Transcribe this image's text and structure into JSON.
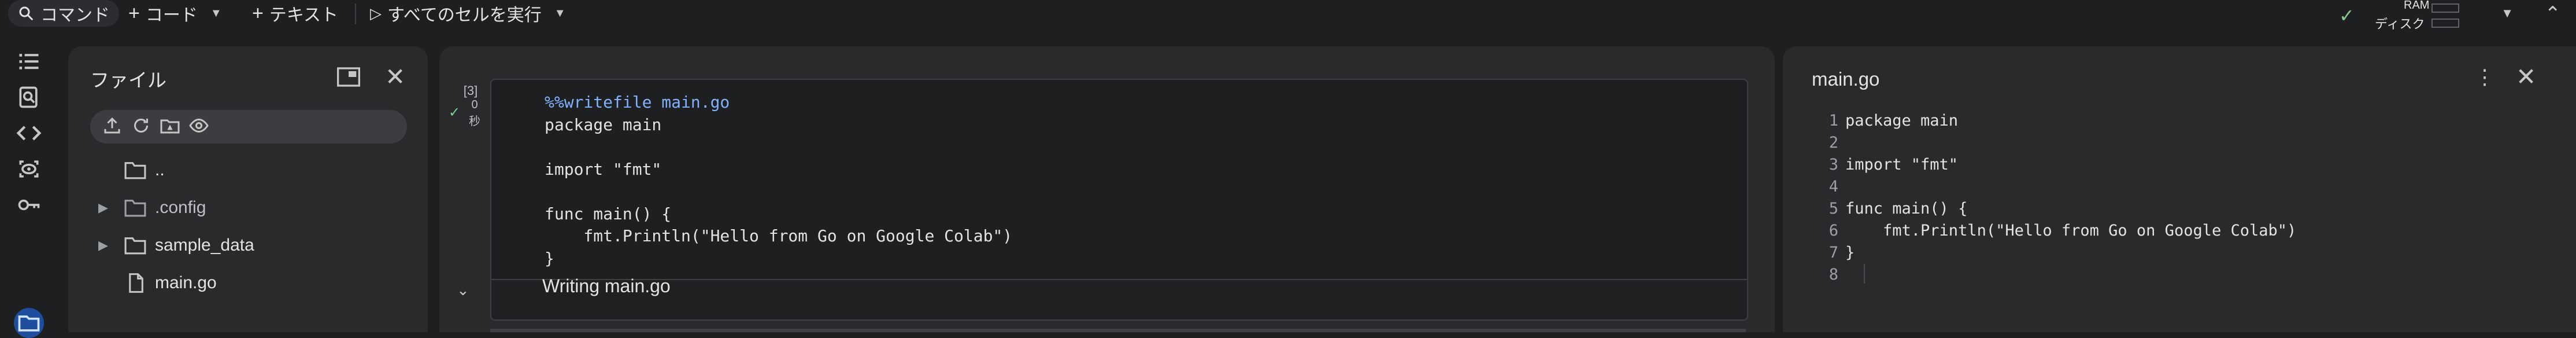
{
  "toolbar": {
    "command_label": "コマンド",
    "code_label": "コード",
    "text_label": "テキスト",
    "run_all_label": "すべてのセルを実行",
    "ram_label": "RAM",
    "disk_label": "ディスク"
  },
  "rail": {
    "icons": [
      "table-of-contents-icon",
      "find-icon",
      "code-snippets-icon",
      "variables-icon",
      "secrets-key-icon",
      "files-icon"
    ],
    "active_color": "#1f4e9e"
  },
  "files_panel": {
    "title": "ファイル",
    "tree": [
      {
        "name": "..",
        "type": "folder"
      },
      {
        "name": ".config",
        "type": "folder"
      },
      {
        "name": "sample_data",
        "type": "folder"
      },
      {
        "name": "main.go",
        "type": "file"
      }
    ]
  },
  "cell": {
    "exec_count": "[3]",
    "exec_time_value": "0",
    "exec_time_unit": "秒",
    "code_lines": [
      "%%writefile main.go",
      "package main",
      "",
      "import \"fmt\"",
      "",
      "func main() {",
      "    fmt.Println(\"Hello from Go on Google Colab\")",
      "}"
    ],
    "output": "Writing main.go"
  },
  "editor": {
    "title": "main.go",
    "line_numbers": [
      "1",
      "2",
      "3",
      "4",
      "5",
      "6",
      "7",
      "8"
    ],
    "lines": [
      "package main",
      "",
      "import \"fmt\"",
      "",
      "func main() {",
      "    fmt.Println(\"Hello from Go on Google Colab\")",
      "}",
      ""
    ]
  },
  "colors": {
    "background": "#1e1f20",
    "panel": "#282a2c",
    "success": "#81c995",
    "magic_keyword": "#82b1ff"
  }
}
